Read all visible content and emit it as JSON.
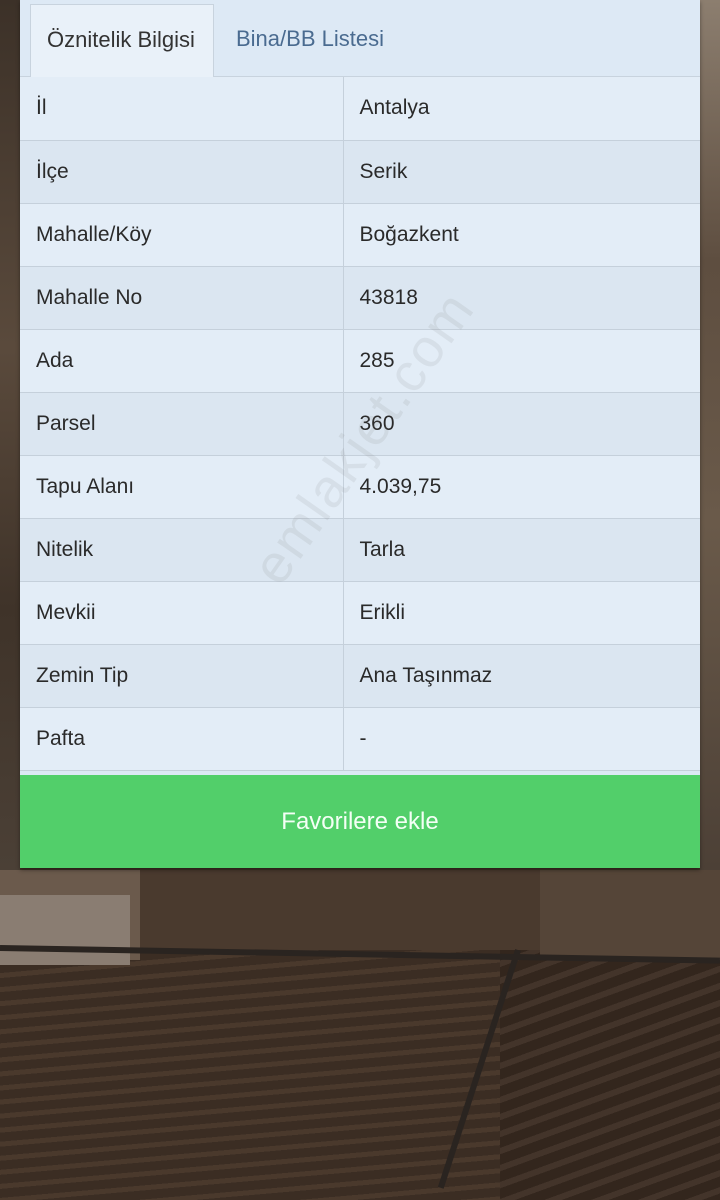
{
  "tabs": [
    {
      "label": "Öznitelik Bilgisi",
      "active": true
    },
    {
      "label": "Bina/BB Listesi",
      "active": false
    }
  ],
  "attributes": [
    {
      "label": "İl",
      "value": "Antalya"
    },
    {
      "label": "İlçe",
      "value": "Serik"
    },
    {
      "label": "Mahalle/Köy",
      "value": "Boğazkent"
    },
    {
      "label": "Mahalle No",
      "value": "43818"
    },
    {
      "label": "Ada",
      "value": "285"
    },
    {
      "label": "Parsel",
      "value": "360"
    },
    {
      "label": "Tapu Alanı",
      "value": "4.039,75"
    },
    {
      "label": "Nitelik",
      "value": "Tarla"
    },
    {
      "label": "Mevkii",
      "value": "Erikli"
    },
    {
      "label": "Zemin Tip",
      "value": "Ana Taşınmaz"
    },
    {
      "label": "Pafta",
      "value": "-"
    }
  ],
  "actions": {
    "favorite_label": "Favorilere ekle"
  },
  "watermark": "emlakjet.com",
  "colors": {
    "button_green": "#52cf6a",
    "panel_bg": "#dde9f5",
    "tab_inactive_text": "#4a6b90"
  }
}
